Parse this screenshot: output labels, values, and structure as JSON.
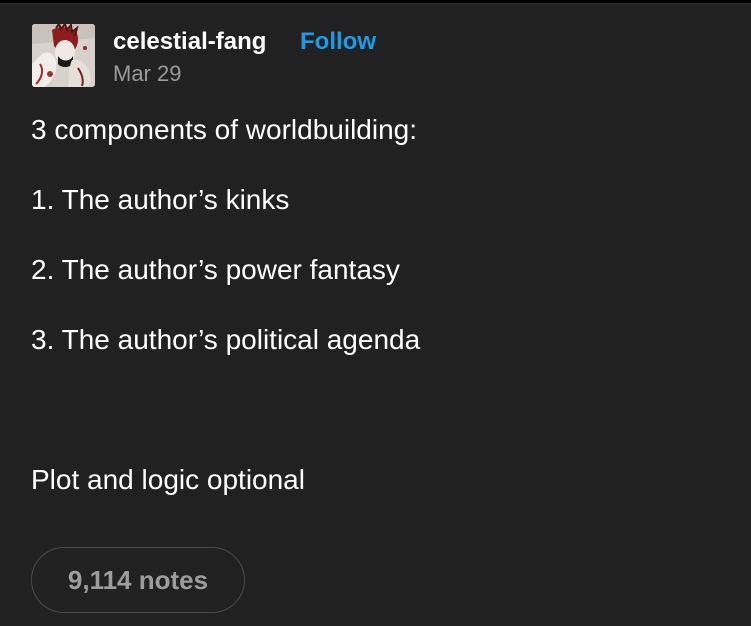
{
  "post": {
    "blog_name": "celestial-fang",
    "follow_label": "Follow",
    "date": "Mar 29",
    "avatar_icon": "blog-avatar",
    "body_lines": [
      "3 components of worldbuilding:",
      "1. The author’s kinks",
      "2. The author’s power fantasy",
      "3. The author’s political agenda",
      "Plot and logic optional"
    ],
    "notes_label": "9,114 notes"
  },
  "colors": {
    "background": "#212121",
    "text": "#ffffff",
    "follow": "#1b9bea",
    "muted": "#9a9a9a",
    "pill_border": "#4b4b4b"
  }
}
